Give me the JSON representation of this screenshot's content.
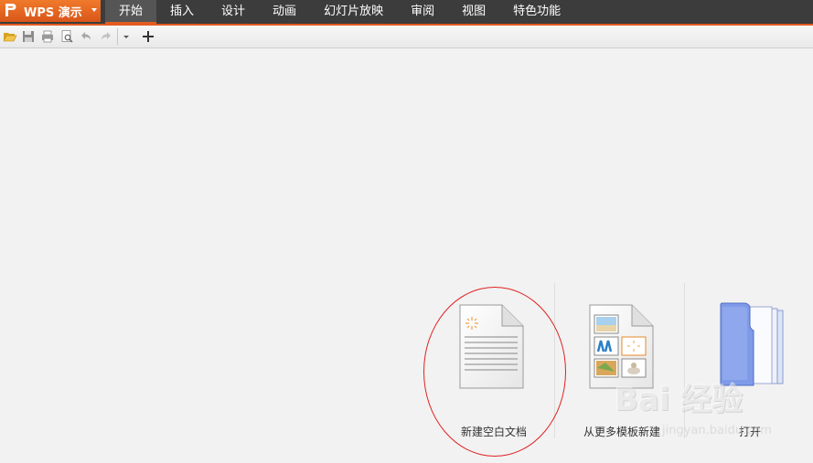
{
  "app": {
    "title": "WPS 演示"
  },
  "tabs": [
    {
      "label": "开始",
      "active": true
    },
    {
      "label": "插入"
    },
    {
      "label": "设计"
    },
    {
      "label": "动画"
    },
    {
      "label": "幻灯片放映"
    },
    {
      "label": "审阅"
    },
    {
      "label": "视图"
    },
    {
      "label": "特色功能"
    }
  ],
  "toolbar": {
    "icons": [
      "open-folder-icon",
      "save-icon",
      "print-icon",
      "print-preview-icon",
      "undo-icon",
      "redo-icon",
      "customize-dropdown-icon",
      "add-icon"
    ]
  },
  "start_options": [
    {
      "label": "新建空白文档",
      "icon": "blank-document-icon"
    },
    {
      "label": "从更多模板新建",
      "icon": "template-document-icon"
    },
    {
      "label": "打开",
      "icon": "folder-open-icon"
    }
  ],
  "watermark": {
    "main": "Bai 经验",
    "sub": "jingyan.baidu.com"
  },
  "colors": {
    "accent": "#e35b21",
    "menubar": "#3c3c3c",
    "background": "#f2f2f2",
    "highlight": "#e02020"
  }
}
